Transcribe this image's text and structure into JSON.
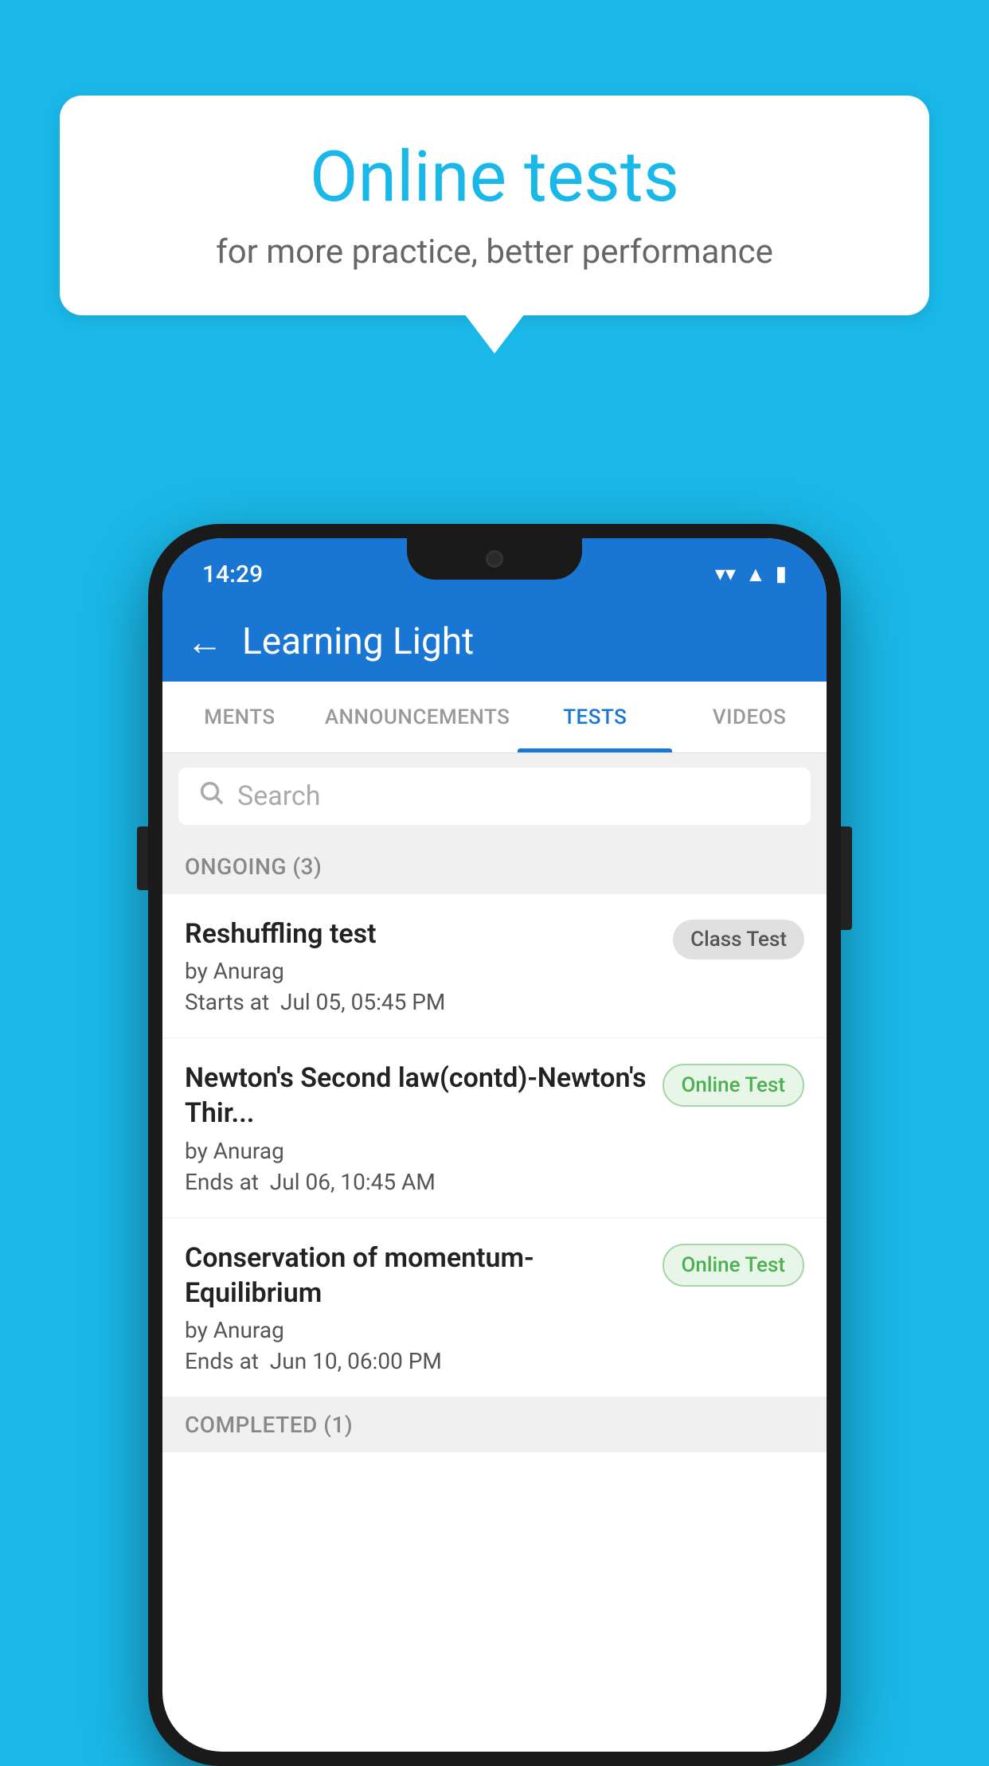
{
  "background": {
    "color": "#1ab8e8"
  },
  "bubble": {
    "title": "Online tests",
    "subtitle": "for more practice, better performance"
  },
  "phone": {
    "status": {
      "time": "14:29",
      "wifi_icon": "▼",
      "signal_icon": "▲",
      "battery_icon": "▮"
    },
    "app_bar": {
      "back_label": "←",
      "title": "Learning Light"
    },
    "tabs": [
      {
        "label": "MENTS",
        "active": false
      },
      {
        "label": "ANNOUNCEMENTS",
        "active": false
      },
      {
        "label": "TESTS",
        "active": true
      },
      {
        "label": "VIDEOS",
        "active": false
      }
    ],
    "search": {
      "placeholder": "Search"
    },
    "ongoing_section": {
      "label": "ONGOING (3)"
    },
    "tests": [
      {
        "name": "Reshuffling test",
        "author": "by Anurag",
        "time_label": "Starts at",
        "time_value": "Jul 05, 05:45 PM",
        "badge": "Class Test",
        "badge_type": "class"
      },
      {
        "name": "Newton's Second law(contd)-Newton's Thir...",
        "author": "by Anurag",
        "time_label": "Ends at",
        "time_value": "Jul 06, 10:45 AM",
        "badge": "Online Test",
        "badge_type": "online"
      },
      {
        "name": "Conservation of momentum-Equilibrium",
        "author": "by Anurag",
        "time_label": "Ends at",
        "time_value": "Jun 10, 06:00 PM",
        "badge": "Online Test",
        "badge_type": "online"
      }
    ],
    "completed_section": {
      "label": "COMPLETED (1)"
    }
  }
}
